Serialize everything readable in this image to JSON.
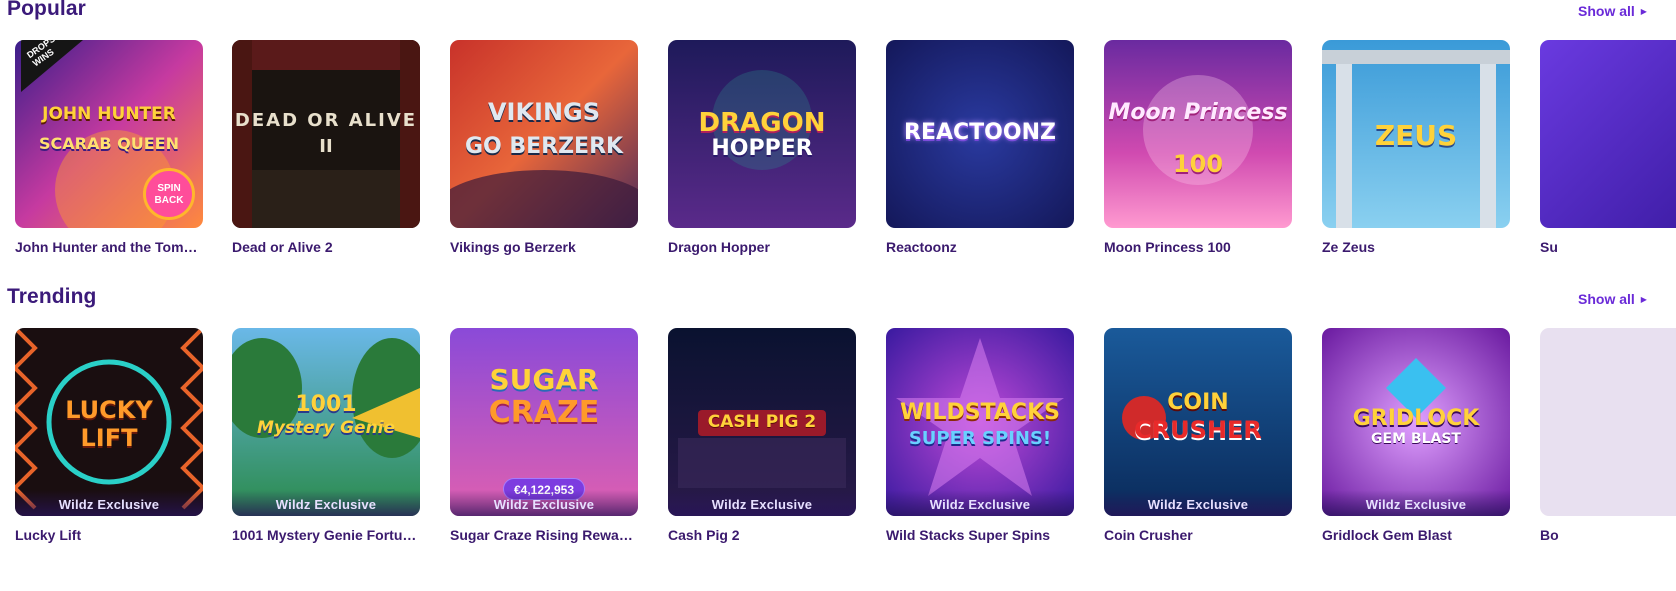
{
  "popular": {
    "title": "Popular",
    "show_all": "Show all",
    "games": [
      {
        "name": "John Hunter and the Tomb…",
        "logo": "JOHN HUNTER",
        "logo2": "SCARAB QUEEN",
        "badge": "DROPS & WINS",
        "spin_back": "SPIN BACK"
      },
      {
        "name": "Dead or Alive 2",
        "logo": "DEAD OR ALIVE",
        "logo2": "II"
      },
      {
        "name": "Vikings go Berzerk",
        "logo": "VIKINGS",
        "logo2": "GO BERZERK"
      },
      {
        "name": "Dragon Hopper",
        "logo": "DRAGON",
        "logo2": "HOPPER"
      },
      {
        "name": "Reactoonz",
        "logo": "REACTOONZ"
      },
      {
        "name": "Moon Princess 100",
        "logo": "Moon Princess",
        "logo2": "100"
      },
      {
        "name": "Ze Zeus",
        "logo": "ZEUS"
      },
      {
        "name": "Su",
        "logo": ""
      }
    ]
  },
  "trending": {
    "title": "Trending",
    "show_all": "Show all",
    "exclusive_label": "Wildz Exclusive",
    "games": [
      {
        "name": "Lucky Lift",
        "logo": "LUCKY",
        "logo2": "LIFT",
        "exclusive": true
      },
      {
        "name": "1001 Mystery Genie Fortunes",
        "logo": "1001",
        "logo2": "Mystery Genie",
        "exclusive": true
      },
      {
        "name": "Sugar Craze Rising Rewar…",
        "logo": "SUGAR",
        "logo2": "CRAZE",
        "jackpot": "€4,122,953",
        "exclusive": true
      },
      {
        "name": "Cash Pig 2",
        "logo": "CASH PIG 2",
        "exclusive": true
      },
      {
        "name": "Wild Stacks Super Spins",
        "logo": "WILDSTACKS",
        "logo2": "SUPER SPINS!",
        "exclusive": true
      },
      {
        "name": "Coin Crusher",
        "logo": "COIN",
        "logo2": "CRUSHER",
        "exclusive": true
      },
      {
        "name": "Gridlock Gem Blast",
        "logo": "GRIDLOCK",
        "logo2": "GEM BLAST",
        "exclusive": true
      },
      {
        "name": "Bo",
        "logo": ""
      }
    ]
  }
}
